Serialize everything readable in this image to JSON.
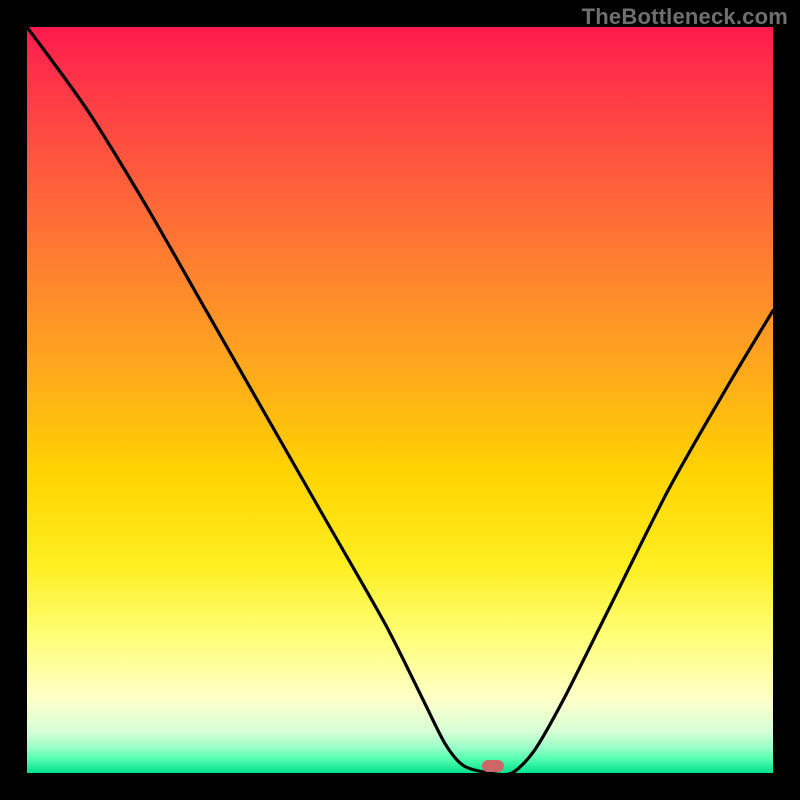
{
  "watermark": "TheBottleneck.com",
  "chart_data": {
    "type": "line",
    "title": "",
    "xlabel": "",
    "ylabel": "",
    "xlim": [
      0,
      100
    ],
    "ylim": [
      0,
      100
    ],
    "series": [
      {
        "name": "curve",
        "x": [
          0,
          8,
          16,
          24,
          32,
          40,
          48,
          53,
          56,
          58.5,
          62,
          65,
          68,
          72,
          78,
          86,
          94,
          100
        ],
        "values": [
          100,
          89,
          76,
          62,
          48,
          34,
          20,
          10,
          4,
          1,
          0,
          0,
          3,
          10,
          22,
          38,
          52,
          62
        ]
      }
    ],
    "marker": {
      "x": 62.5,
      "y": 0,
      "color": "#ce6868"
    },
    "background_gradient": {
      "top": "#ff1a4d",
      "mid": "#ffd400",
      "bottom": "#00e28c"
    }
  }
}
